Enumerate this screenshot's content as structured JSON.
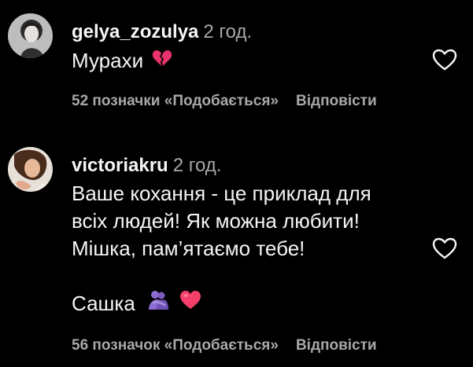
{
  "comments": [
    {
      "username": "gelya_zozulya",
      "time": "2 год.",
      "text_lines": [
        "Мурахи"
      ],
      "emoji_after_text": "broken-heart-icon",
      "likes_label": "52 позначки «Подобається»",
      "reply_label": "Відповісти"
    },
    {
      "username": "victoriakru",
      "time": "2 год.",
      "text_lines": [
        "Ваше кохання - це приклад для",
        "всіх людей! Як можна любити!",
        "Мішка, пам’ятаємо тебе!",
        "",
        "Сашка"
      ],
      "emoji_after_text": [
        "people-hugging-icon",
        "pink-heart-icon"
      ],
      "likes_label": "56 позначок «Подобається»",
      "reply_label": "Відповісти"
    }
  ],
  "colors": {
    "background": "#000000",
    "primary_text": "#f5f5f5",
    "secondary_text": "#a8a8a8",
    "broken_heart": "#e8336d",
    "pink_heart": "#f43f6b",
    "hug_purple": "#8e6bd1"
  }
}
